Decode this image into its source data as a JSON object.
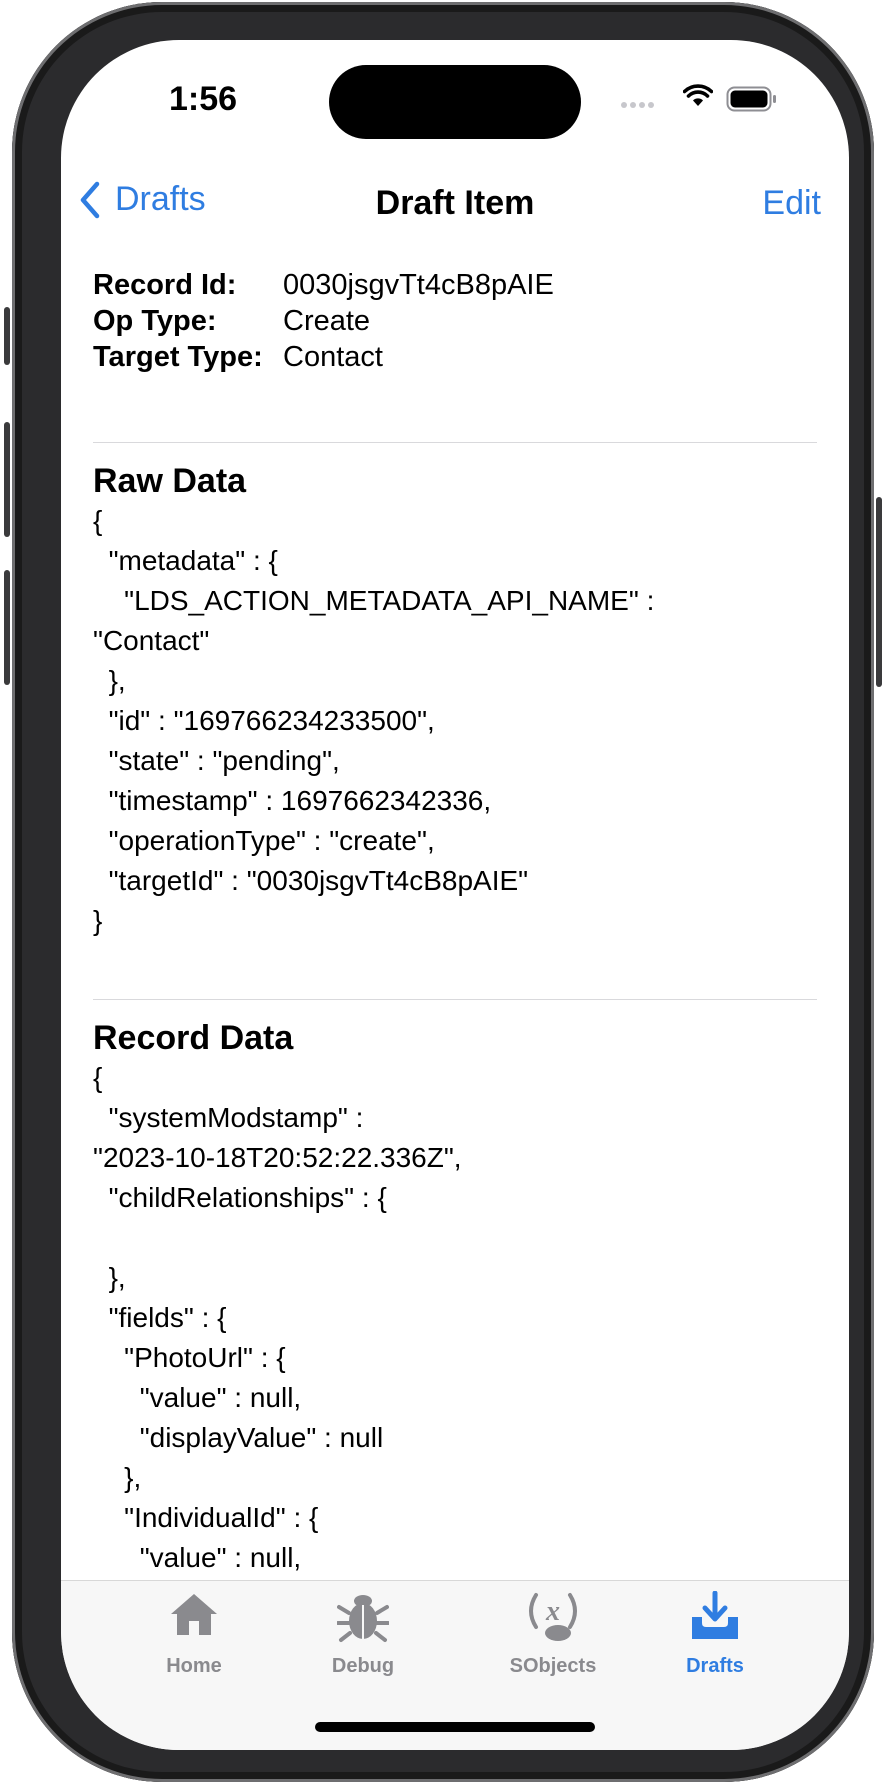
{
  "status_bar": {
    "time": "1:56"
  },
  "nav": {
    "back_label": "Drafts",
    "title": "Draft Item",
    "edit_label": "Edit"
  },
  "info": [
    {
      "label": "Record Id:",
      "value": "0030jsgvTt4cB8pAIE"
    },
    {
      "label": "Op Type:",
      "value": "Create"
    },
    {
      "label": "Target Type:",
      "value": "Contact"
    }
  ],
  "raw_data": {
    "title": "Raw Data",
    "text": "{\n  \"metadata\" : {\n    \"LDS_ACTION_METADATA_API_NAME\" : \n\"Contact\"\n  },\n  \"id\" : \"169766234233500\",\n  \"state\" : \"pending\",\n  \"timestamp\" : 1697662342336,\n  \"operationType\" : \"create\",\n  \"targetId\" : \"0030jsgvTt4cB8pAIE\"\n}"
  },
  "record_data": {
    "title": "Record Data",
    "text": "{\n  \"systemModstamp\" : \n\"2023-10-18T20:52:22.336Z\",\n  \"childRelationships\" : {\n\n  },\n  \"fields\" : {\n    \"PhotoUrl\" : {\n      \"value\" : null,\n      \"displayValue\" : null\n    },\n    \"IndividualId\" : {\n      \"value\" : null,"
  },
  "tabs": [
    {
      "label": "Home",
      "icon": "house-icon",
      "active": false
    },
    {
      "label": "Debug",
      "icon": "bug-icon",
      "active": false
    },
    {
      "label": "SObjects",
      "icon": "function-icon",
      "active": false
    },
    {
      "label": "Drafts",
      "icon": "tray-download-icon",
      "active": true
    }
  ],
  "colors": {
    "accent": "#2f7de1",
    "tab_inactive": "#8a8a8e"
  }
}
